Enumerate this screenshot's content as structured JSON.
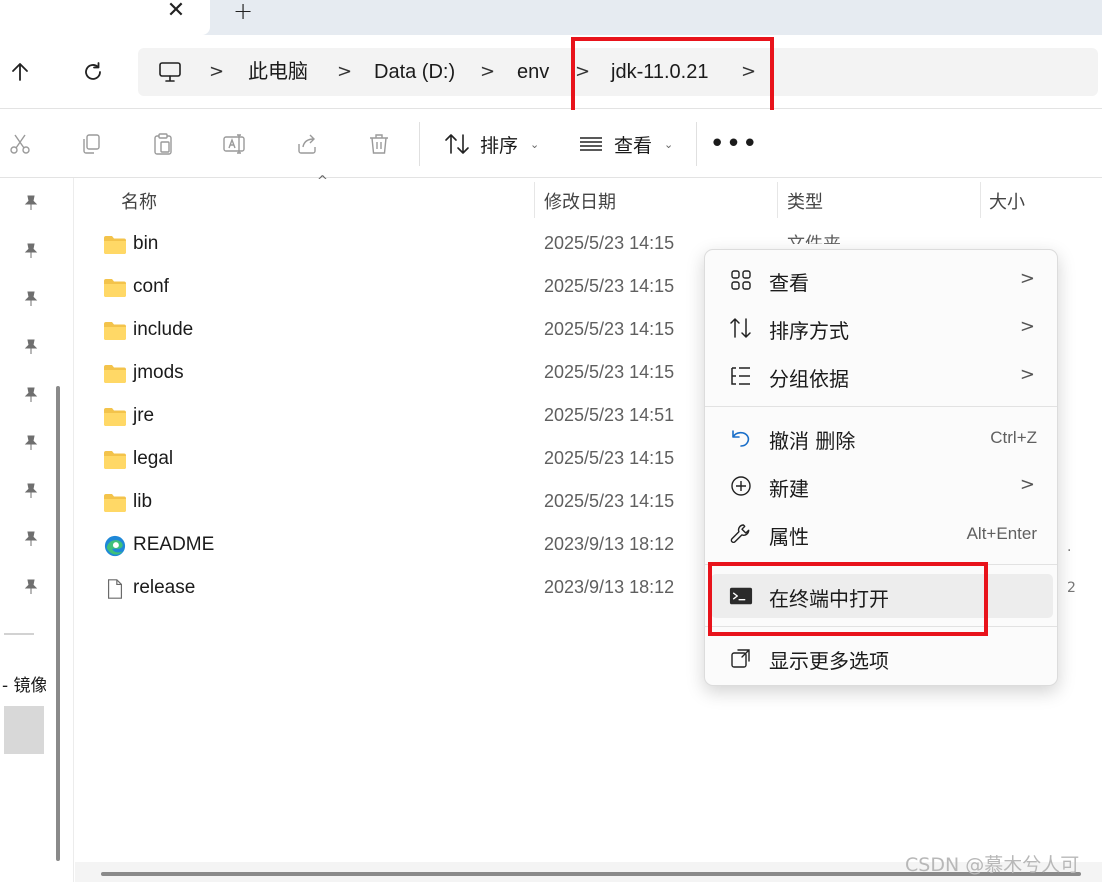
{
  "tabs": {
    "close_glyph": "✕",
    "new_glyph": "+"
  },
  "nav": {
    "up_icon": "arrow-up-icon",
    "refresh_icon": "refresh-icon",
    "breadcrumbs": [
      "此电脑",
      "Data (D:)",
      "env",
      "jdk-11.0.21"
    ],
    "separator": ">"
  },
  "toolbar": {
    "sort_label": "排序",
    "view_label": "查看",
    "more_label": "•••"
  },
  "list": {
    "columns": {
      "name": "名称",
      "date": "修改日期",
      "type": "类型",
      "size": "大小"
    },
    "visible_type_fragment": "文件夹",
    "rows": [
      {
        "name": "bin",
        "date": "2025/5/23 14:15",
        "icon": "folder-icon"
      },
      {
        "name": "conf",
        "date": "2025/5/23 14:15",
        "icon": "folder-icon"
      },
      {
        "name": "include",
        "date": "2025/5/23 14:15",
        "icon": "folder-icon"
      },
      {
        "name": "jmods",
        "date": "2025/5/23 14:15",
        "icon": "folder-icon"
      },
      {
        "name": "jre",
        "date": "2025/5/23 14:51",
        "icon": "folder-icon"
      },
      {
        "name": "legal",
        "date": "2025/5/23 14:15",
        "icon": "folder-icon"
      },
      {
        "name": "lib",
        "date": "2025/5/23 14:15",
        "icon": "folder-icon"
      },
      {
        "name": "README",
        "date": "2023/9/13 18:12",
        "icon": "edge-browser-icon"
      },
      {
        "name": "release",
        "date": "2023/9/13 18:12",
        "icon": "file-icon"
      }
    ]
  },
  "sidebar": {
    "partial_label": "- 镜像"
  },
  "context_menu": {
    "items": [
      {
        "label": "查看",
        "shortcut": "",
        "submenu": true,
        "icon": "grid-view-icon"
      },
      {
        "label": "排序方式",
        "shortcut": "",
        "submenu": true,
        "icon": "sort-icon"
      },
      {
        "label": "分组依据",
        "shortcut": "",
        "submenu": true,
        "icon": "group-by-icon"
      },
      {
        "label": "撤消 删除",
        "shortcut": "Ctrl+Z",
        "submenu": false,
        "icon": "undo-icon"
      },
      {
        "label": "新建",
        "shortcut": "",
        "submenu": true,
        "icon": "new-plus-icon"
      },
      {
        "label": "属性",
        "shortcut": "Alt+Enter",
        "submenu": false,
        "icon": "wrench-icon"
      },
      {
        "label": "在终端中打开",
        "shortcut": "",
        "submenu": false,
        "icon": "terminal-icon",
        "highlighted": true
      },
      {
        "label": "显示更多选项",
        "shortcut": "",
        "submenu": false,
        "icon": "show-more-icon"
      }
    ],
    "submenu_glyph": ">"
  },
  "annotation": {
    "color": "#e8131b"
  },
  "watermark": "CSDN @慕木兮人可"
}
